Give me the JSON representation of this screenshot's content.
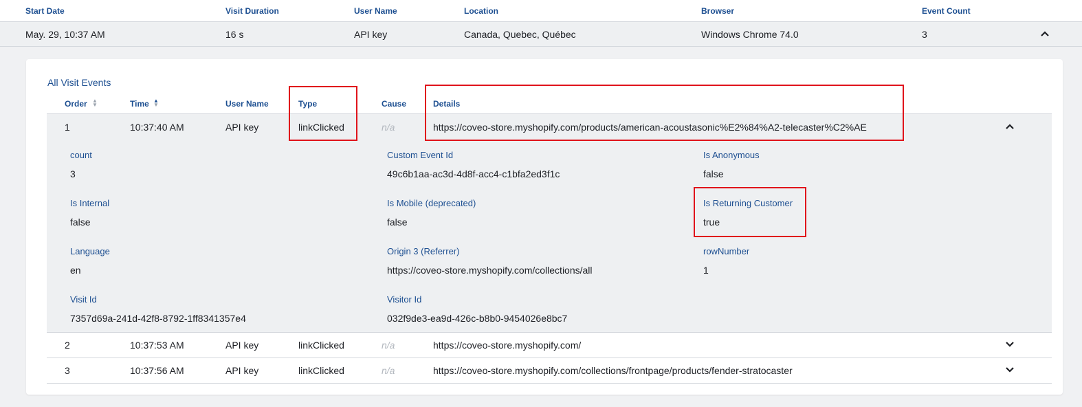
{
  "visits_table": {
    "headers": {
      "start_date": "Start Date",
      "visit_duration": "Visit Duration",
      "user_name": "User Name",
      "location": "Location",
      "browser": "Browser",
      "event_count": "Event Count"
    },
    "row": {
      "start_date": "May. 29, 10:37 AM",
      "visit_duration": "16 s",
      "user_name": "API key",
      "location": "Canada, Quebec, Québec",
      "browser": "Windows Chrome 74.0",
      "event_count": "3"
    }
  },
  "events_card": {
    "title": "All Visit Events",
    "headers": {
      "order": "Order",
      "time": "Time",
      "user_name": "User Name",
      "type": "Type",
      "cause": "Cause",
      "details": "Details"
    },
    "rows": [
      {
        "order": "1",
        "time": "10:37:40 AM",
        "user_name": "API key",
        "type": "linkClicked",
        "cause": "n/a",
        "details": "https://coveo-store.myshopify.com/products/american-acoustasonic%E2%84%A2-telecaster%C2%AE"
      },
      {
        "order": "2",
        "time": "10:37:53 AM",
        "user_name": "API key",
        "type": "linkClicked",
        "cause": "n/a",
        "details": "https://coveo-store.myshopify.com/"
      },
      {
        "order": "3",
        "time": "10:37:56 AM",
        "user_name": "API key",
        "type": "linkClicked",
        "cause": "n/a",
        "details": "https://coveo-store.myshopify.com/collections/frontpage/products/fender-stratocaster"
      }
    ],
    "event_details": [
      {
        "label": "count",
        "value": "3"
      },
      {
        "label": "Custom Event Id",
        "value": "49c6b1aa-ac3d-4d8f-acc4-c1bfa2ed3f1c"
      },
      {
        "label": "Is Anonymous",
        "value": "false"
      },
      {
        "label": "Is Internal",
        "value": "false"
      },
      {
        "label": "Is Mobile (deprecated)",
        "value": "false"
      },
      {
        "label": "Is Returning Customer",
        "value": "true"
      },
      {
        "label": "Language",
        "value": "en"
      },
      {
        "label": "Origin 3 (Referrer)",
        "value": "https://coveo-store.myshopify.com/collections/all"
      },
      {
        "label": "rowNumber",
        "value": "1"
      },
      {
        "label": "Visit Id",
        "value": "7357d69a-241d-42f8-8792-1ff8341357e4"
      },
      {
        "label": "Visitor Id",
        "value": "032f9de3-ea9d-426c-b8b0-9454026e8bc7"
      }
    ]
  },
  "icons": {
    "expanded": "chevron-up-icon",
    "collapsed": "chevron-down-icon",
    "sort": "sort-icon"
  },
  "colors": {
    "header_text": "#1d4f91",
    "highlight_box": "#e0131b",
    "muted_text": "#b3b8bf"
  }
}
